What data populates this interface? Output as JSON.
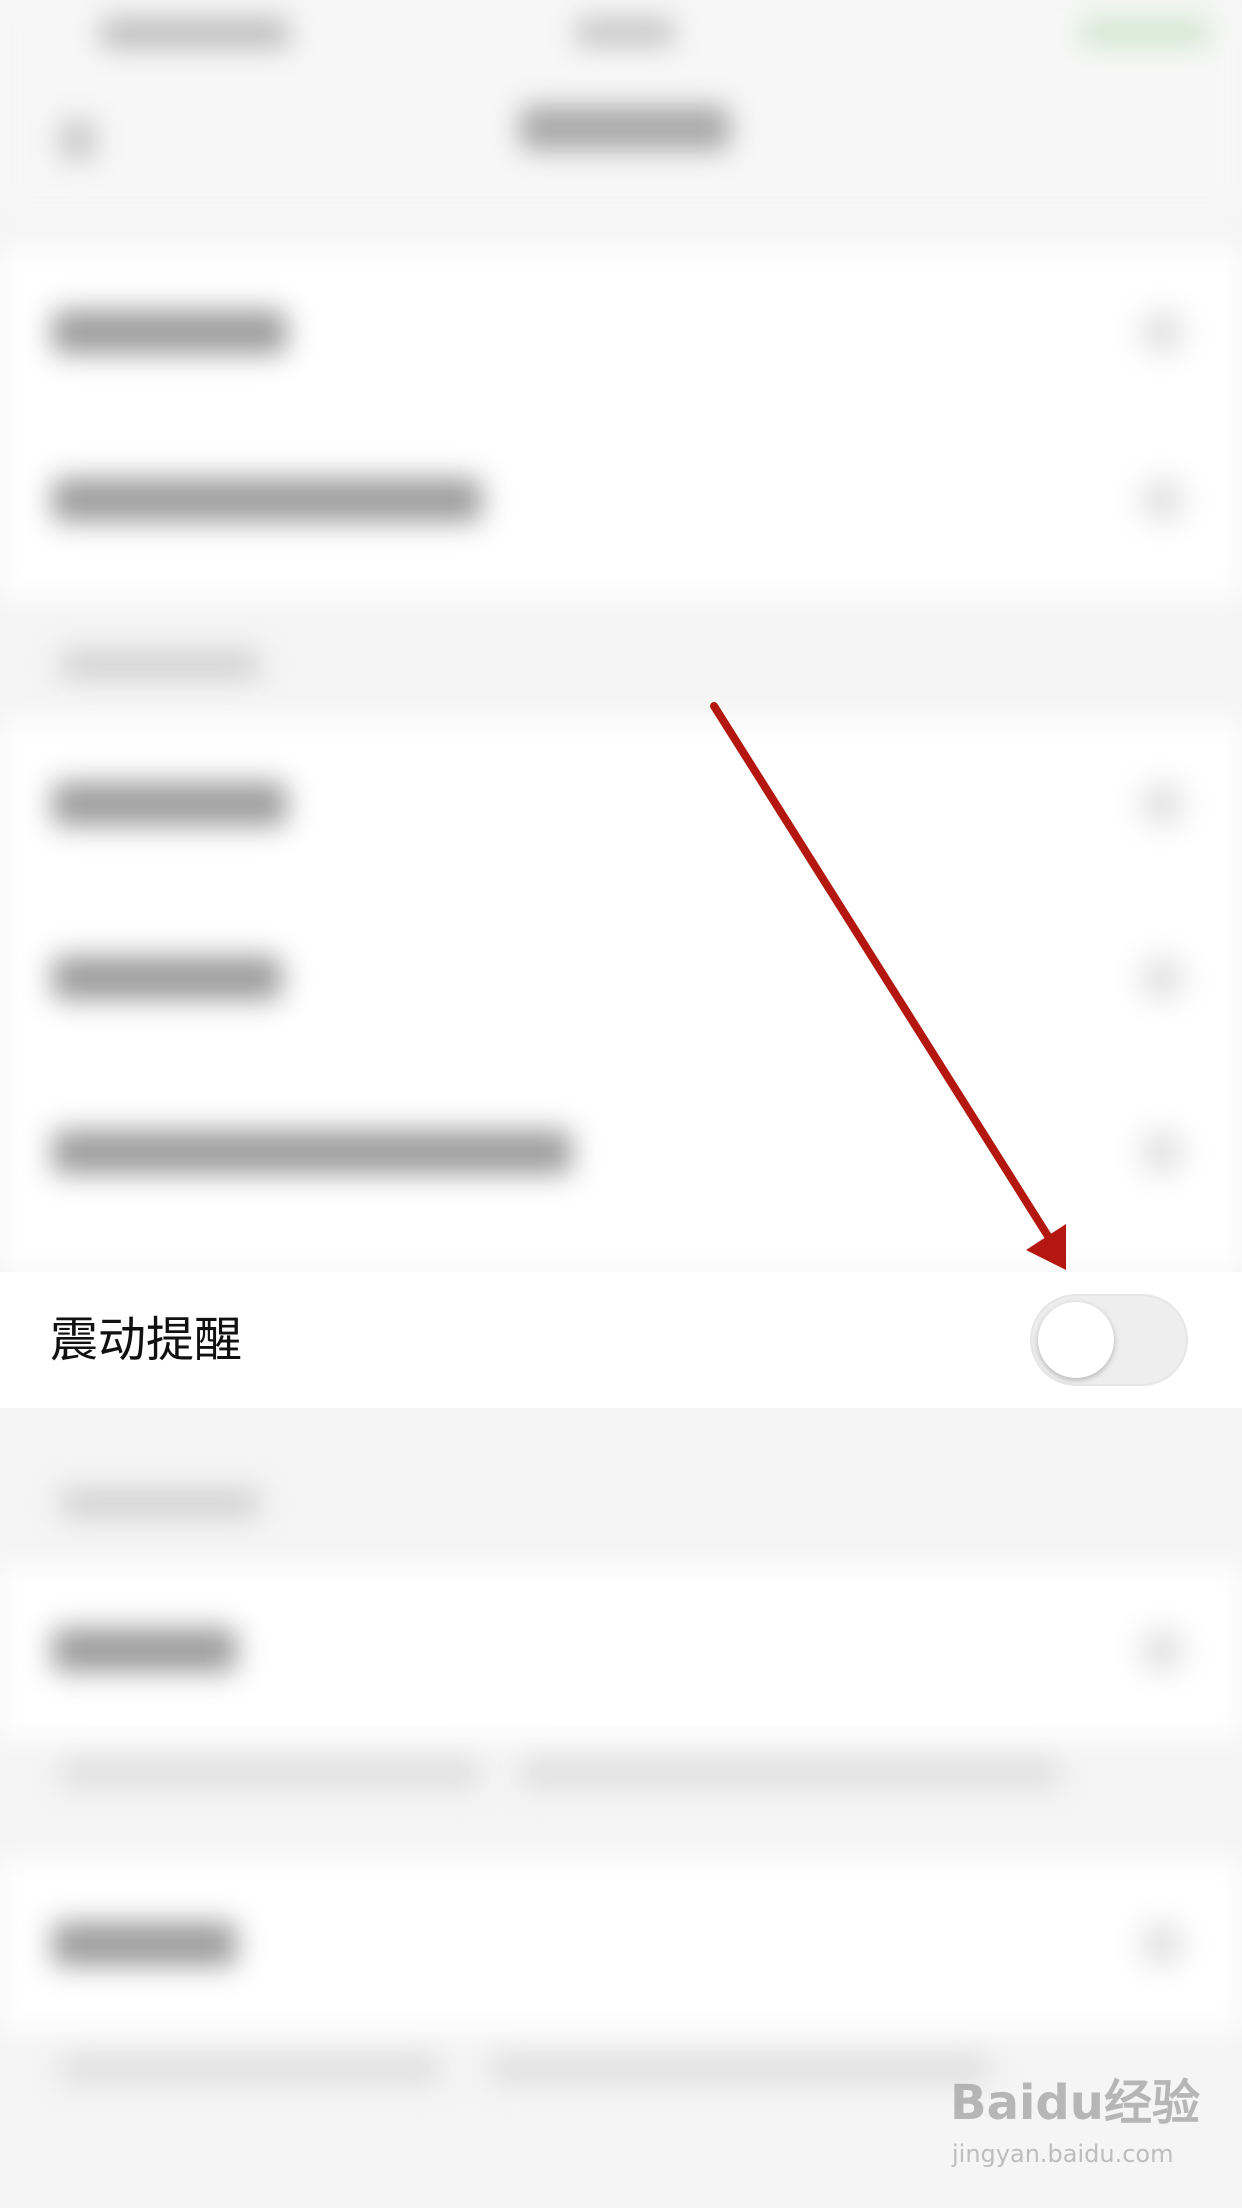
{
  "settings": {
    "focused_row": {
      "label": "震动提醒",
      "toggle_on": false
    }
  },
  "annotation": {
    "arrow_color": "#b3170f"
  },
  "watermark": {
    "logo": "Baidu经验",
    "url": "jingyan.baidu.com"
  },
  "colors": {
    "background": "#f5f5f5",
    "row_background": "#ffffff",
    "toggle_off": "#eeeeee"
  }
}
